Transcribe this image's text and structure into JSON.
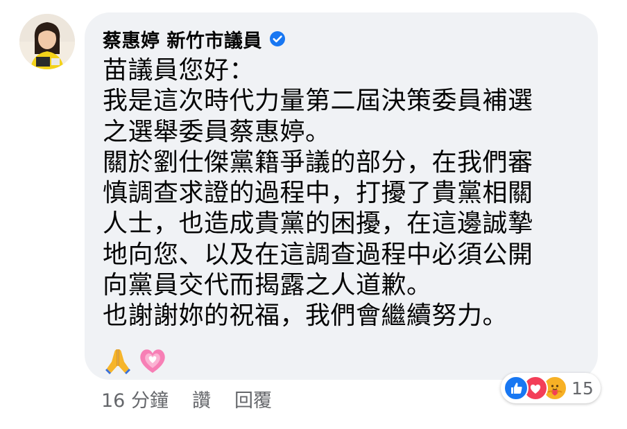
{
  "comment": {
    "author": "蔡惠婷 新竹市議員",
    "lines": [
      "苗議員您好：",
      "我是這次時代力量第二屆決策委員補選",
      "之選舉委員蔡惠婷。",
      "關於劉仕傑黨籍爭議的部分，在我們審",
      "慎調查求證的過程中，打擾了貴黨相關",
      "人士，也造成貴黨的困擾，在這邊誠摯",
      "地向您、以及在這調查過程中必須公開",
      "向黨員交代而揭露之人道歉。",
      "也謝謝妳的祝福，我們會繼續努力。"
    ],
    "emojis": [
      "folded-hands",
      "growing-heart"
    ]
  },
  "actions": {
    "time": "16 分鐘",
    "like": "讚",
    "reply": "回覆"
  },
  "reactions": {
    "icons": [
      "like",
      "love",
      "care"
    ],
    "count": "15"
  },
  "colors": {
    "bubble": "#f0f2f5",
    "text": "#050505",
    "secondary": "#65676b",
    "verified": "#1877f2",
    "like": "#1877f2",
    "love": "#f33e58",
    "care": "#f7b125"
  }
}
